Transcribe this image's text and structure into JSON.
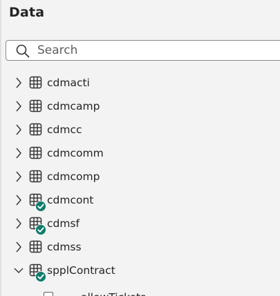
{
  "pane": {
    "title": "Data"
  },
  "search": {
    "placeholder": "Search"
  },
  "tables": [
    {
      "name": "cdmacti",
      "expanded": false,
      "checked": false
    },
    {
      "name": "cdmcamp",
      "expanded": false,
      "checked": false
    },
    {
      "name": "cdmcc",
      "expanded": false,
      "checked": false
    },
    {
      "name": "cdmcomm",
      "expanded": false,
      "checked": false
    },
    {
      "name": "cdmcomp",
      "expanded": false,
      "checked": false
    },
    {
      "name": "cdmcont",
      "expanded": false,
      "checked": true
    },
    {
      "name": "cdmsf",
      "expanded": false,
      "checked": true
    },
    {
      "name": "cdmss",
      "expanded": false,
      "checked": false
    },
    {
      "name": "spplContract",
      "expanded": true,
      "checked": true
    }
  ],
  "fields": [
    {
      "name": "allowTickets",
      "selected": false
    }
  ],
  "colors": {
    "check_badge": "#107c6c",
    "background": "#f3f3f3"
  }
}
